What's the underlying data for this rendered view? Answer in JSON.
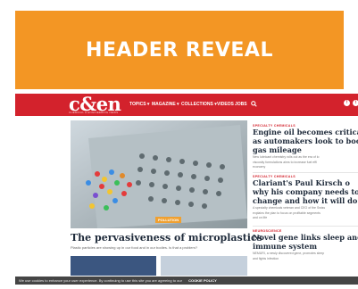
{
  "banner": {
    "title": "HEADER REVEAL",
    "color": "#f39624"
  },
  "site": {
    "logo": "c&en",
    "tagline": "CHEMICAL & ENGINEERING NEWS",
    "brand_color": "#d3222c",
    "nav": [
      "TOPICS ▾",
      "MAGAZINE ▾",
      "COLLECTIONS ▾",
      "VIDEOS",
      "JOBS"
    ],
    "search_icon": "search-icon",
    "social_icons": [
      "facebook-icon",
      "twitter-icon"
    ]
  },
  "main_story": {
    "label": "POLLUTION",
    "headline": "The pervasiveness of microplastics",
    "subhead": "Plastic particles are showing up in our food and in our bodies. Is that a problem?"
  },
  "sidebar": [
    {
      "category": "SPECIALTY CHEMICALS",
      "headline_lines": [
        "Engine oil becomes critica",
        "as automakers look to boo",
        "gas mileage"
      ],
      "meta_lines": [
        "New lubricant chemistry rolls out as the era of lo",
        "viscosity formulations aims to increase fuel effi",
        "economy"
      ]
    },
    {
      "category": "SPECIALTY CHEMICALS",
      "headline_lines": [
        "Clariant's Paul Kirsch o",
        "why his company needs to",
        "change and how it will do i"
      ],
      "meta_lines": [
        "A specialty chemicals veteran and CEO of the Swiss",
        "explains the plan to focus on profitable segments",
        "and on life"
      ]
    },
    {
      "category": "NEUROSCIENCE",
      "headline_lines": [
        "Novel gene links sleep and",
        "immune system"
      ],
      "meta_lines": [
        "NEMURI, a newly discovered gene, promotes sleep",
        "and fights infection"
      ]
    }
  ],
  "cookie_bar": {
    "text": "We use cookies to enhance your user experience. By continuing to use this site you are agreeing to our",
    "button": "COOKIE POLICY"
  }
}
